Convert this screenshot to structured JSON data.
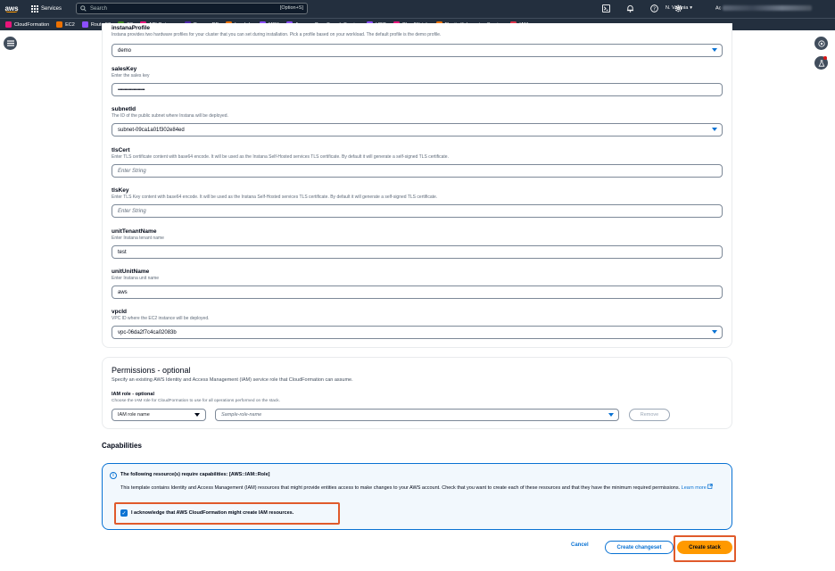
{
  "topnav": {
    "logo": "aws",
    "services_label": "Services",
    "search_placeholder": "Search",
    "search_shortcut": "[Option+S]",
    "region": "N. Virginia",
    "account_prefix": "Ac"
  },
  "favorites": [
    {
      "label": "CloudFormation",
      "color": "#e7157b"
    },
    {
      "label": "EC2",
      "color": "#ed7100"
    },
    {
      "label": "Route 53",
      "color": "#8c4fff"
    },
    {
      "label": "S3",
      "color": "#3f8624"
    },
    {
      "label": "API Gateway",
      "color": "#e7157b"
    },
    {
      "label": "DynamoDB",
      "color": "#4d27aa"
    },
    {
      "label": "Lambda",
      "color": "#ed7100"
    },
    {
      "label": "MSK",
      "color": "#8c4fff"
    },
    {
      "label": "Amazon OpenSearch Service",
      "color": "#8c4fff"
    },
    {
      "label": "VPC",
      "color": "#8c4fff"
    },
    {
      "label": "CloudWatch",
      "color": "#e7157b"
    },
    {
      "label": "Elastic Kubernetes Service",
      "color": "#ed7100"
    },
    {
      "label": "IAM",
      "color": "#dd344c"
    }
  ],
  "parameters": {
    "top_partial_name": "instanaProfile",
    "top_desc": "Instana provides two hardware profiles for your cluster that you can set during installation. Pick a profile based on your workload. The default profile is the demo profile.",
    "top_value": "demo",
    "salesKey": {
      "name": "salesKey",
      "desc": "Enter the sales key",
      "value": "••••••••••••••••••••••••"
    },
    "subnetId": {
      "name": "subnetId",
      "desc": "The ID of the public subnet where Instana will be deployed.",
      "value": "subnet-09ca1a01f302e84ed"
    },
    "tlsCert": {
      "name": "tlsCert",
      "desc": "Enter TLS certificate content with base64 encode. It will be used as the Instana Self-Hosted services TLS certificate. By default it will generate a self-signed TLS certificate.",
      "placeholder": "Enter String"
    },
    "tlsKey": {
      "name": "tlsKey",
      "desc": "Enter TLS Key content with base64 encode. It will be used as the Instana Self-Hosted services TLS certificate. By default it will generate a self-signed TLS certificate.",
      "placeholder": "Enter String"
    },
    "unitTenantName": {
      "name": "unitTenantName",
      "desc": "Enter Instana tenant name",
      "value": "test"
    },
    "unitUnitName": {
      "name": "unitUnitName",
      "desc": "Enter Instana unit name",
      "value": "aws"
    },
    "vpcId": {
      "name": "vpcId",
      "desc": "VPC ID where the EC2 instance will be deployed.",
      "value": "vpc-06da2f7c4ca02083b"
    }
  },
  "permissions": {
    "title": "Permissions - optional",
    "subtitle": "Specify an existing AWS Identity and Access Management (IAM) service role that CloudFormation can assume.",
    "role_label": "IAM role - optional",
    "role_desc": "Choose the IAM role for CloudFormation to use for all operations performed on the stack.",
    "role_type": "IAM role name",
    "role_placeholder": "Sample-role-name",
    "remove_label": "Remove"
  },
  "capabilities": {
    "title": "Capabilities",
    "heading": "The following resource(s) require capabilities: [AWS::IAM::Role]",
    "body": "This template contains Identity and Access Management (IAM) resources that might provide entities access to make changes to your AWS account. Check that you want to create each of these resources and that they have the minimum required permissions.",
    "learn_more": "Learn more",
    "ack_label": "I acknowledge that AWS CloudFormation might create IAM resources.",
    "ack_checked": true
  },
  "footer": {
    "cancel": "Cancel",
    "create_changeset": "Create changeset",
    "create_stack": "Create stack"
  }
}
